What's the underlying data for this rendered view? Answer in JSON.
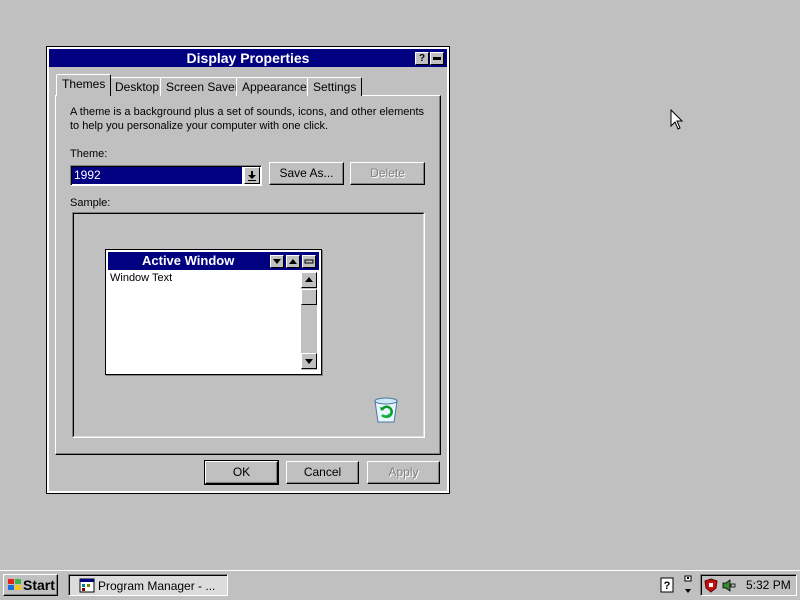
{
  "dialog": {
    "title": "Display Properties",
    "help_glyph": "?",
    "close_glyph": "▬"
  },
  "tabs": [
    {
      "label": "Themes",
      "active": true
    },
    {
      "label": "Desktop",
      "active": false
    },
    {
      "label": "Screen Saver",
      "active": false
    },
    {
      "label": "Appearance",
      "active": false
    },
    {
      "label": "Settings",
      "active": false
    }
  ],
  "themes_panel": {
    "description_line1": "A theme is a background plus a set of sounds, icons, and other elements",
    "description_line2": "to help you personalize your computer with one click.",
    "theme_label": "Theme:",
    "theme_value": "1992",
    "save_as_label": "Save As...",
    "delete_label": "Delete",
    "sample_label": "Sample:"
  },
  "sample_window": {
    "title": "Active Window",
    "text": "Window Text"
  },
  "footer": {
    "ok_label": "OK",
    "cancel_label": "Cancel",
    "apply_label": "Apply"
  },
  "taskbar": {
    "start_label": "Start",
    "task_label": "Program Manager - ...",
    "clock": "5:32 PM"
  },
  "icons": {
    "recycle_bin": "recycle-bin-icon",
    "cursor": "mouse-pointer-icon"
  },
  "colors": {
    "title_bar": "#000080",
    "face": "#c0c0c0",
    "desktop": "#c0c0c0"
  }
}
